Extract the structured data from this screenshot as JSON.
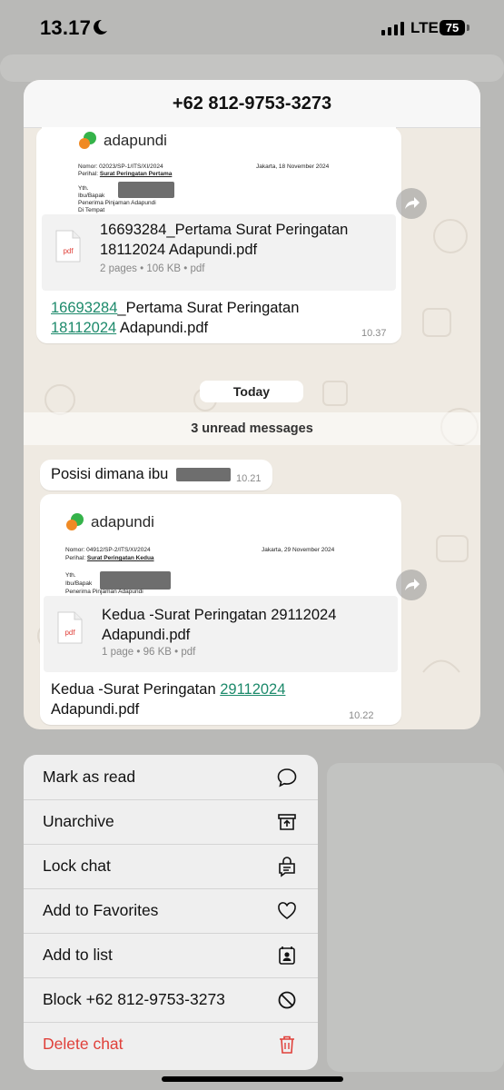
{
  "status_bar": {
    "time": "13.17",
    "network": "LTE",
    "battery": "75"
  },
  "chat": {
    "title": "+62 812-9753-3273",
    "date_divider": "Today",
    "unread_divider": "3 unread messages",
    "messages": [
      {
        "type": "document",
        "preview": {
          "logo": "adapundi",
          "nomor": "Nomor: 02023/SP-1/ITS/XI/2024",
          "date": "Jakarta, 18 November 2024",
          "perihal_label": "Perihal:",
          "perihal": "Surat Peringatan Pertama",
          "yth": "Yth.",
          "recipient": "Ibu/Bapak",
          "line3": "Penerima Pinjaman Adapundi",
          "line4": "Di Tempat"
        },
        "file_name": "16693284_Pertama Surat Peringatan 18112024 Adapundi.pdf",
        "file_meta": "2 pages • 106 KB • pdf",
        "caption_link1": "16693284",
        "caption_mid": "_Pertama Surat Peringatan",
        "caption_link2": "18112024",
        "caption_end": " Adapundi.pdf",
        "time": "10.37"
      },
      {
        "type": "text",
        "text": "Posisi dimana ibu",
        "time": "10.21"
      },
      {
        "type": "document",
        "preview": {
          "logo": "adapundi",
          "nomor": "Nomor: 04912/SP-2/ITS/XI/2024",
          "date": "Jakarta, 29 November 2024",
          "perihal_label": "Perihal:",
          "perihal": "Surat Peringatan Kedua",
          "yth": "Yth.",
          "recipient": "Ibu/Bapak",
          "line3": "Penerima Pinjaman Adapundi"
        },
        "file_name": "Kedua -Surat Peringatan 29112024 Adapundi.pdf",
        "file_meta": "1 page • 96 KB • pdf",
        "caption_start": "Kedua -Surat Peringatan ",
        "caption_link": "29112024",
        "caption_end": "Adapundi.pdf",
        "time": "10.22"
      }
    ],
    "pdf_label": "pdf"
  },
  "context_menu": {
    "items": [
      {
        "label": "Mark as read",
        "icon": "chat-bubble-icon"
      },
      {
        "label": "Unarchive",
        "icon": "unarchive-icon"
      },
      {
        "label": "Lock chat",
        "icon": "lock-chat-icon"
      },
      {
        "label": "Add to Favorites",
        "icon": "heart-icon"
      },
      {
        "label": "Add to list",
        "icon": "contact-list-icon"
      },
      {
        "label": "Block +62 812-9753-3273",
        "icon": "block-icon"
      },
      {
        "label": "Delete chat",
        "icon": "trash-icon",
        "color": "#e0403a"
      }
    ]
  }
}
